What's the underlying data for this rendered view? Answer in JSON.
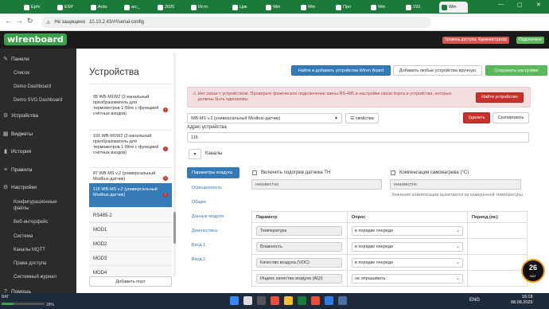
{
  "browser": {
    "tabs": [
      "Ерhi",
      "ESP",
      "Ardu",
      "arc_",
      "2025",
      "Исто",
      "Цик",
      "Win",
      "Win",
      "Про",
      "Win",
      "192.",
      "Win"
    ],
    "url_warning": "Не защищено",
    "url": "10.10.2.43/#!/serial-config"
  },
  "header": {
    "logo": "wirenboard",
    "access_level": "Уровень доступа: Администратор",
    "connection": "Подключено"
  },
  "sidebar": {
    "items": [
      {
        "icon": "✎",
        "label": "Панели"
      },
      {
        "label": "Список"
      },
      {
        "label": "Demo Dashboard"
      },
      {
        "label": "Demo SVG Dashboard"
      },
      {
        "icon": "⚙",
        "label": "Устройства"
      },
      {
        "icon": "▦",
        "label": "Виджеты"
      },
      {
        "icon": "▮",
        "label": "История"
      },
      {
        "icon": "≡",
        "label": "Правила"
      },
      {
        "icon": "⚙",
        "label": "Настройки"
      },
      {
        "label": "Конфигурационные файлы"
      },
      {
        "label": "Веб-интерфейс"
      },
      {
        "label": "Система"
      },
      {
        "label": "Каналы MQTT"
      },
      {
        "label": "Права доступа"
      },
      {
        "label": "Системный журнал"
      },
      {
        "icon": "?",
        "label": "Помощь"
      }
    ]
  },
  "page": {
    "title": "Устройства",
    "find_button": "Найти и добавить устройства Wiren Board",
    "add_any_button": "Добавить любые устройства вручную",
    "save_button": "Сохранить настройки"
  },
  "devices": [
    {
      "label": "95 WB-M1W2 (2-канальный преобразователь для термометров 1-Wire с функцией счётных входов)",
      "error": true
    },
    {
      "label": "191 WB-M1W2 (2-канальный преобразователь для термометров 1-Wire с функцией счётных входов)",
      "error": true
    },
    {
      "label": "87 WB-MS v.2 (универсальный Modbus-датчик)",
      "error": true
    },
    {
      "label": "116 WB-MS v.2 (универсальный Modbus-датчик)",
      "error": true
    }
  ],
  "ports": [
    "RS485-2",
    "MOD1",
    "MOD2",
    "MOD3",
    "MOD4"
  ],
  "add_port_button": "Добавить порт",
  "alert": {
    "text": "Нет связи с устройством. Проверьте физическое подключение шины RS-485 и настройки связи порта и устройства, которые должны быть одинаковы",
    "button": "Найти устройство"
  },
  "device": {
    "type": "WB-MS v.2 (универсальный Modbus-датчик)",
    "props_button": "свойства",
    "delete_button": "Удалить",
    "copy_button": "Скопировать",
    "address_label": "Адрес устройства",
    "address_value": "116",
    "channels_label": "Каналы"
  },
  "param_tabs": [
    "Параметры воздуха",
    "Освещенность",
    "Общее",
    "Данные модуля",
    "Диагностика",
    "Вход 1",
    "Вход 2"
  ],
  "settings": {
    "heater_label": "Включить подогрев датчика TH",
    "heater_value": "неизвестно",
    "compensation_label": "Компенсация самонагрева (°C)",
    "compensation_value": "неизвестно",
    "compensation_hint": "Значение компенсации вычитается из измеренной температуры"
  },
  "table": {
    "headers": [
      "Параметр",
      "Опрос",
      "Период (мс)"
    ],
    "rows": [
      {
        "name": "Температура",
        "poll": "в порядке очереди"
      },
      {
        "name": "Влажность",
        "poll": "в порядке очереди"
      },
      {
        "name": "Качество воздуха (VOC)",
        "poll": "в порядке очереди"
      },
      {
        "name": "Индекс качества воздуха (AQI)",
        "poll": "не опрашивать"
      }
    ]
  },
  "taskbar": {
    "battery_label": "BAT",
    "battery_percent": "28%",
    "battery_level": 0.28,
    "lang": "ENG",
    "time": "16:18",
    "date": "08.08.2025",
    "gauge_value": "26",
    "gauge_unit": "BAT"
  }
}
